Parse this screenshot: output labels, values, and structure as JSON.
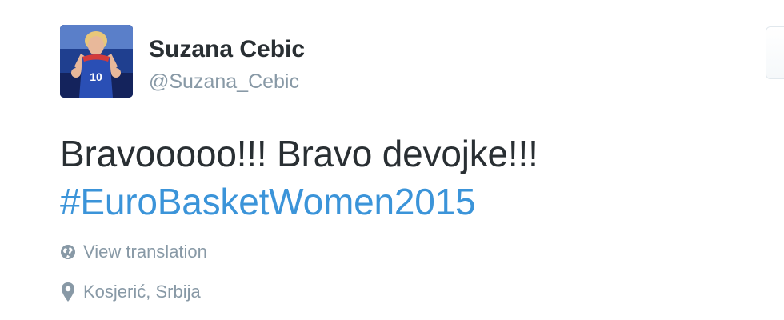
{
  "user": {
    "name": "Suzana Cebic",
    "screen_name": "@Suzana_Cebic",
    "avatar_jersey_number": "10"
  },
  "tweet": {
    "text_line1": "Bravooooo!!! Bravo devojke!!!",
    "hashtag": "#EuroBasketWomen2015"
  },
  "actions": {
    "view_translation": "View translation"
  },
  "location": {
    "label": "Kosjerić, Srbija"
  },
  "icons": {
    "translation": "globe-icon",
    "location": "map-pin-icon"
  },
  "colors": {
    "text": "#292f33",
    "muted": "#8899a6",
    "link": "#3b94d9"
  }
}
